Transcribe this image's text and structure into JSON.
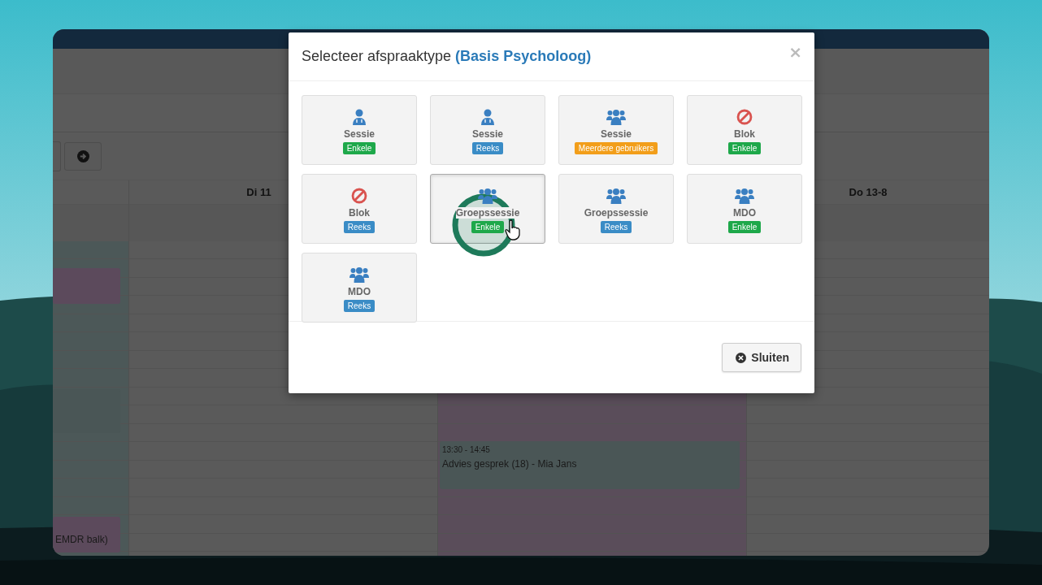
{
  "calendar": {
    "columns": [
      {
        "kind": "time",
        "highlight": false,
        "events": [
          {
            "color": "#5c4a5c"
          },
          {
            "color": "#4a5656"
          },
          {
            "color": "#5c4a5c",
            "title": "EMDR balk)"
          }
        ]
      },
      {
        "kind": "day",
        "label": "Di 11",
        "highlight": false
      },
      {
        "kind": "day",
        "highlight": true,
        "events": [
          {
            "color": "#4a5656",
            "time": "13:30 - 14:45",
            "title": "Advies gesprek (18) - Mia Jans"
          }
        ]
      },
      {
        "kind": "day",
        "label": "Do 13-8",
        "highlight": false
      }
    ]
  },
  "modal": {
    "title": "Selecteer afspraaktype",
    "subtitle": "(Basis Psycholoog)",
    "close": "×",
    "options": [
      {
        "kind": "person",
        "label": "Sessie",
        "badge": {
          "kind": "single",
          "text": "Enkele"
        },
        "hovered": false
      },
      {
        "kind": "person",
        "label": "Sessie",
        "badge": {
          "kind": "series",
          "text": "Reeks"
        },
        "hovered": false
      },
      {
        "kind": "group",
        "label": "Sessie",
        "badge": {
          "kind": "multi",
          "text": "Meerdere gebruikers"
        },
        "hovered": false
      },
      {
        "kind": "block",
        "label": "Blok",
        "badge": {
          "kind": "single",
          "text": "Enkele"
        },
        "hovered": false
      },
      {
        "kind": "block",
        "label": "Blok",
        "badge": {
          "kind": "series",
          "text": "Reeks"
        },
        "hovered": false
      },
      {
        "kind": "group",
        "label": "Groepssessie",
        "badge": {
          "kind": "single",
          "text": "Enkele"
        },
        "hovered": true
      },
      {
        "kind": "group",
        "label": "Groepssessie",
        "badge": {
          "kind": "series",
          "text": "Reeks"
        },
        "hovered": false
      },
      {
        "kind": "group",
        "label": "MDO",
        "badge": {
          "kind": "single",
          "text": "Enkele"
        },
        "hovered": false
      },
      {
        "kind": "group",
        "label": "MDO",
        "badge": {
          "kind": "series",
          "text": "Reeks"
        },
        "hovered": false
      }
    ],
    "footer_button": {
      "label": "Sluiten"
    }
  }
}
